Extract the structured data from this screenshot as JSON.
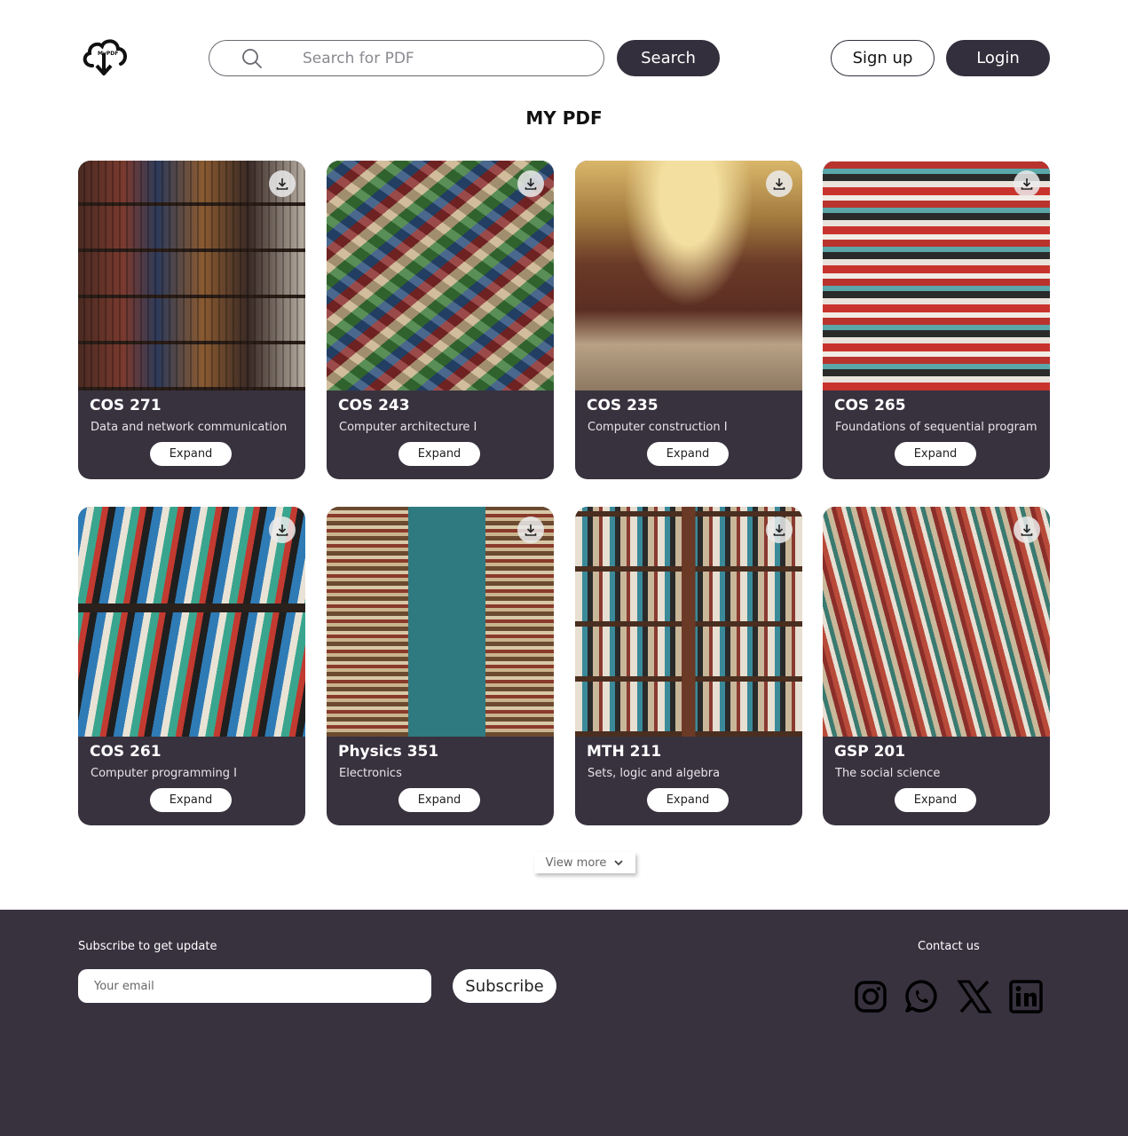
{
  "header": {
    "search_placeholder": "Search for PDF",
    "search_button": "Search",
    "signup_button": "Sign up",
    "login_button": "Login"
  },
  "page_title": "MY PDF",
  "cards": [
    {
      "code": "COS 271",
      "description": "Data and network communication",
      "button": "Expand"
    },
    {
      "code": "COS 243",
      "description": "Computer architecture I",
      "button": "Expand"
    },
    {
      "code": "COS 235",
      "description": "Computer construction I",
      "button": "Expand"
    },
    {
      "code": "COS 265",
      "description": "Foundations of sequential program",
      "button": "Expand"
    },
    {
      "code": "COS 261",
      "description": "Computer programming I",
      "button": "Expand"
    },
    {
      "code": "Physics 351",
      "description": "Electronics",
      "button": "Expand"
    },
    {
      "code": "MTH 211",
      "description": "Sets, logic and algebra",
      "button": "Expand"
    },
    {
      "code": "GSP 201",
      "description": "The social science",
      "button": "Expand"
    }
  ],
  "view_more": "View more",
  "footer": {
    "subscribe_label": "Subscribe to get update",
    "email_placeholder": "Your email",
    "subscribe_button": "Subscribe",
    "contact_label": "Contact us",
    "social_icons": [
      "instagram-icon",
      "whatsapp-icon",
      "x-icon",
      "linkedin-icon"
    ]
  },
  "colors": {
    "dark": "#38323f",
    "button_dark": "#342f3c",
    "white": "#ffffff"
  }
}
